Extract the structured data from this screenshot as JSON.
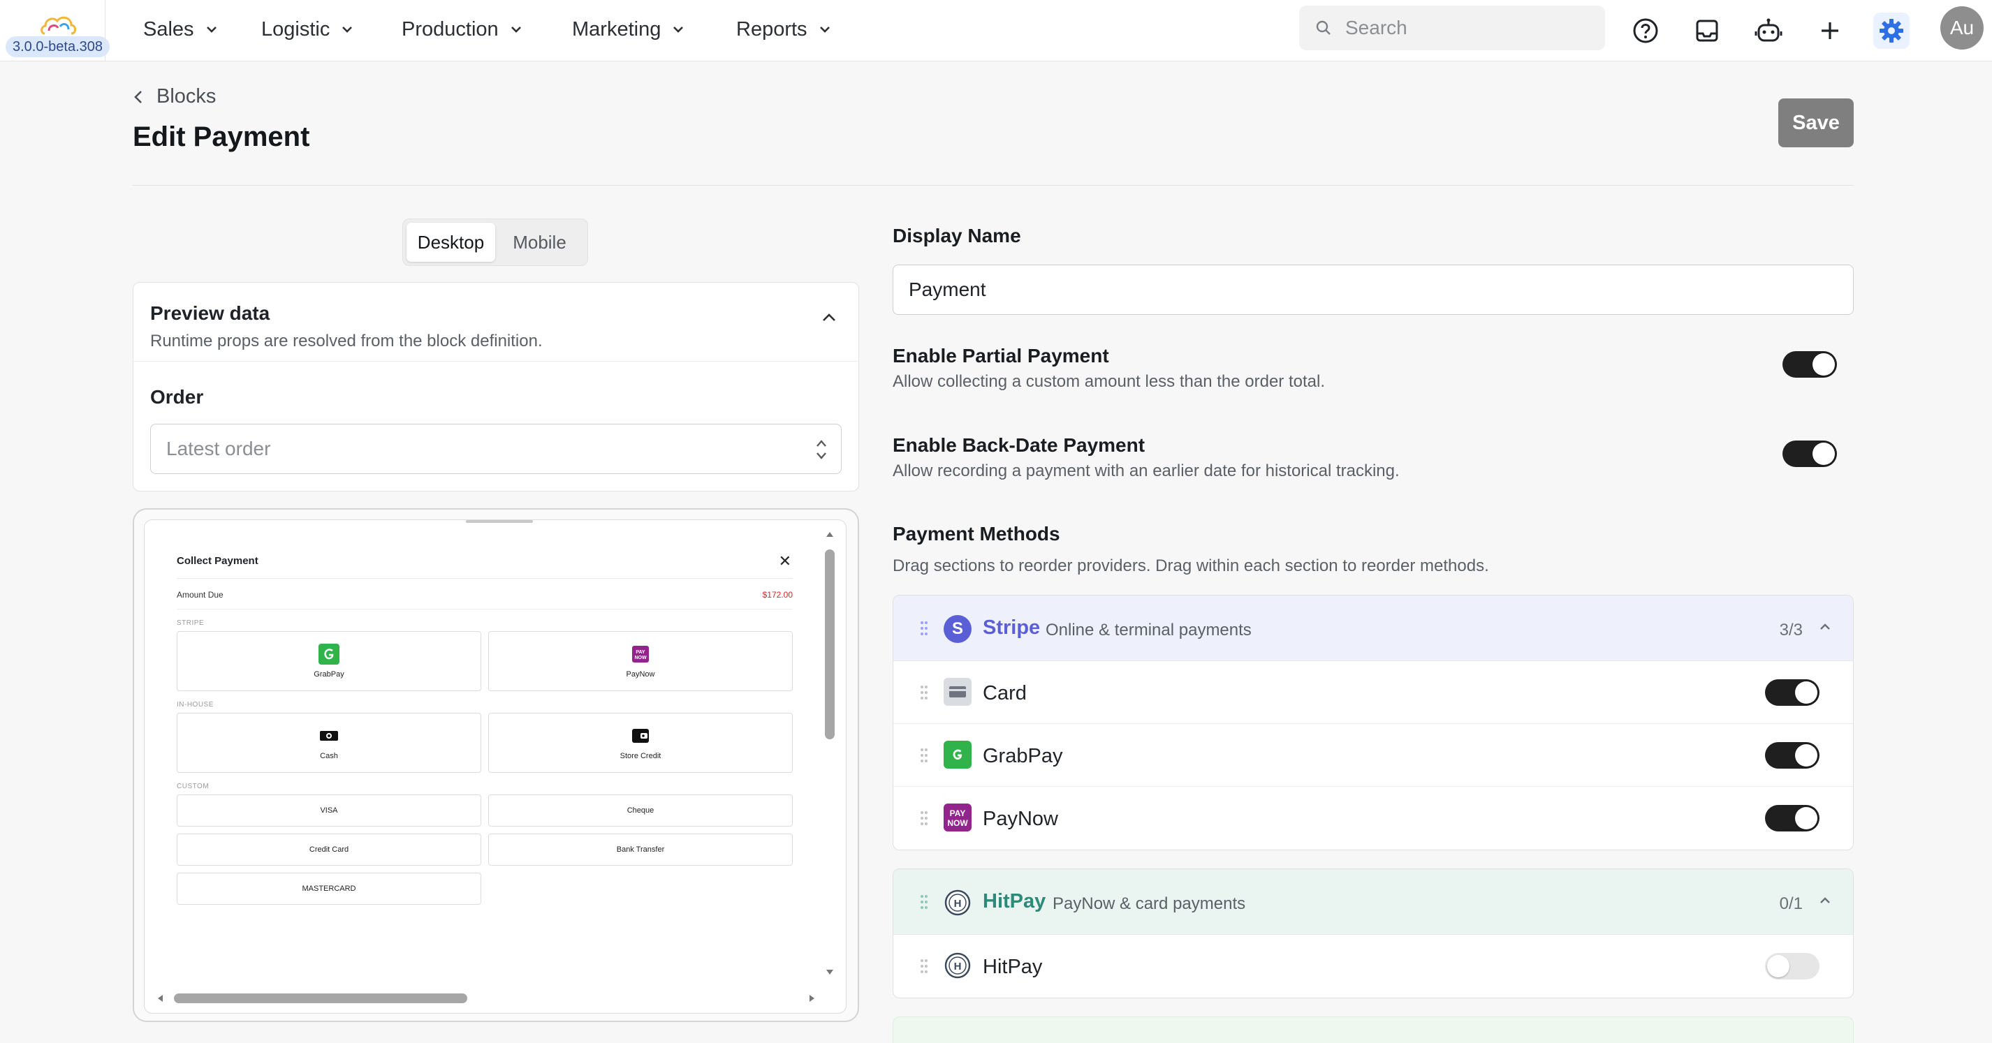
{
  "app": {
    "version": "3.0.0-beta.308",
    "nav": [
      {
        "label": "Sales"
      },
      {
        "label": "Logistic"
      },
      {
        "label": "Production"
      },
      {
        "label": "Marketing"
      },
      {
        "label": "Reports"
      }
    ],
    "search_placeholder": "Search",
    "avatar_initials": "Au",
    "toolbar_icons": [
      "help-icon",
      "inbox-icon",
      "bot-icon",
      "plus-icon",
      "gear-icon"
    ],
    "accent": "#2f6fe4"
  },
  "page": {
    "breadcrumb": "Blocks",
    "title": "Edit Payment",
    "save_label": "Save"
  },
  "preview": {
    "tabs": [
      "Desktop",
      "Mobile"
    ],
    "active_tab": "Desktop",
    "card_title": "Preview data",
    "card_subtitle": "Runtime props are resolved from the block definition.",
    "order_label": "Order",
    "order_placeholder": "Latest order",
    "modal": {
      "title": "Collect Payment",
      "amount_label": "Amount Due",
      "amount_value": "$172.00",
      "sections": [
        {
          "label": "STRIPE",
          "items": [
            "GrabPay",
            "PayNow"
          ]
        },
        {
          "label": "IN-HOUSE",
          "items": [
            "Cash",
            "Store Credit"
          ]
        },
        {
          "label": "CUSTOM",
          "items": [
            "VISA",
            "Cheque",
            "Credit Card",
            "Bank Transfer",
            "MASTERCARD"
          ]
        }
      ]
    }
  },
  "form": {
    "display_name_label": "Display Name",
    "display_name_value": "Payment",
    "partial": {
      "title": "Enable Partial Payment",
      "desc": "Allow collecting a custom amount less than the order total.",
      "enabled": true
    },
    "backdate": {
      "title": "Enable Back-Date Payment",
      "desc": "Allow recording a payment with an earlier date for historical tracking.",
      "enabled": true
    },
    "methods_title": "Payment Methods",
    "methods_desc": "Drag sections to reorder providers. Drag within each section to reorder methods.",
    "providers": [
      {
        "name": "Stripe",
        "desc": "Online & terminal payments",
        "count": "3/3",
        "color": "#5b5fd6",
        "methods": [
          {
            "name": "Card",
            "enabled": true
          },
          {
            "name": "GrabPay",
            "enabled": true
          },
          {
            "name": "PayNow",
            "enabled": true
          }
        ]
      },
      {
        "name": "HitPay",
        "desc": "PayNow & card payments",
        "count": "0/1",
        "color": "#2d8a78",
        "methods": [
          {
            "name": "HitPay",
            "enabled": false
          }
        ]
      }
    ]
  }
}
